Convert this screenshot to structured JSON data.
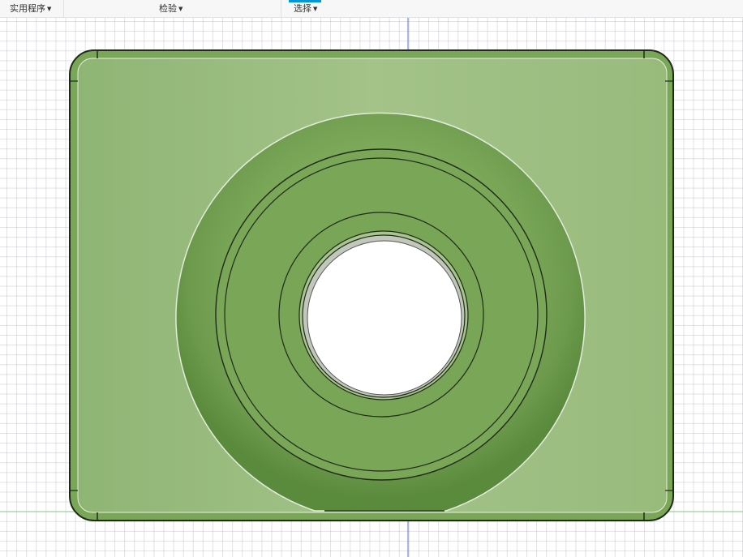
{
  "toolbar": {
    "menus": [
      {
        "label": "实用程序"
      },
      {
        "label": "检验"
      },
      {
        "label": "选择"
      }
    ]
  },
  "viewport": {
    "colors": {
      "body": "#9fc083",
      "body_edge": "#6f9a52",
      "boss": "#7aa757",
      "boss_dark": "#5e8a3f",
      "outline": "#1f2a18",
      "axis_blue": "#5a6fd6",
      "axis_green": "#7fcf7f"
    }
  }
}
